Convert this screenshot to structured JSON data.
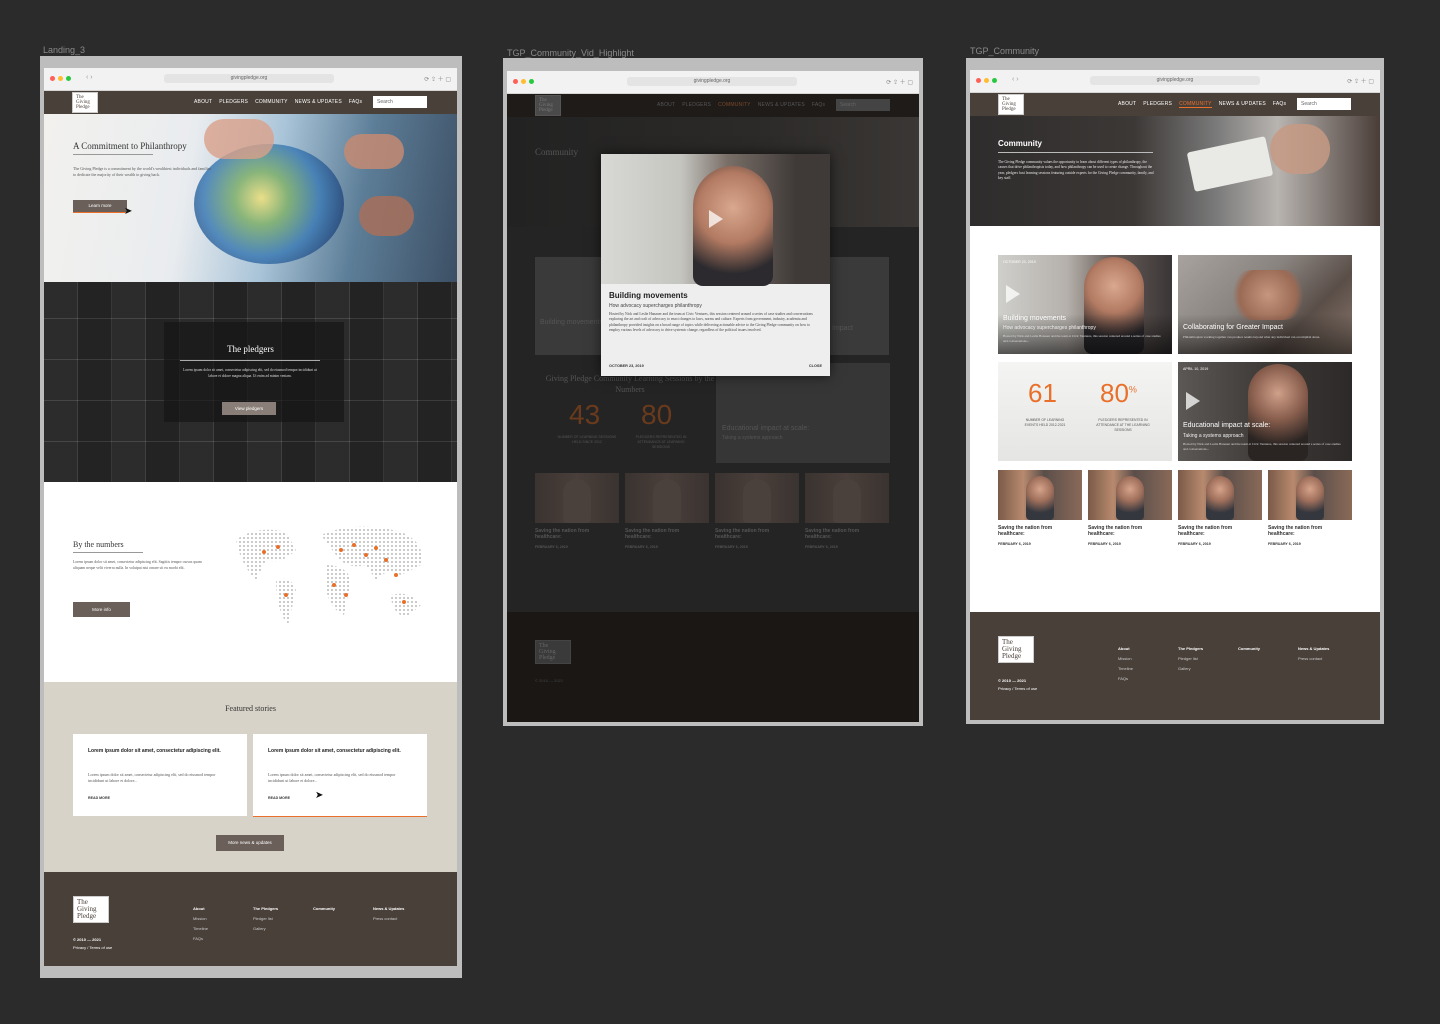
{
  "frames": {
    "landing_label": "Landing_3",
    "video_label": "TGP_Community_Vid_Highlight",
    "community_label": "TGP_Community"
  },
  "browser": {
    "url": "givingpledge.org"
  },
  "logo": {
    "l1": "The",
    "l2": "Giving",
    "l3": "Pledge"
  },
  "nav": {
    "about": "ABOUT",
    "pledgers": "PLEDGERS",
    "community": "COMMUNITY",
    "news": "NEWS & UPDATES",
    "faqs": "FAQs",
    "search_placeholder": "Search"
  },
  "landing": {
    "hero_title": "A Commitment to Philanthropy",
    "hero_body": "The Giving Pledge is a commitment by the world's wealthiest individuals and families to dedicate the majority of their wealth to giving back.",
    "hero_button": "Learn more",
    "pledgers_title": "The pledgers",
    "pledgers_body": "Lorem ipsum dolor sit amet, consectetur adipiscing elit, sed do eiusmod tempor incididunt ut labore et dolore magna aliqua. Ut enim ad minim veniam.",
    "pledgers_button": "View pledgers",
    "numbers_title": "By the numbers",
    "numbers_body": "Lorem ipsum dolor sit amet, consectetur adipiscing elit. Sagittis tempor cursus quam aliquam neque velit viverra nulla. In volutpat nisi ornare sit eu morbi elit.",
    "numbers_button": "More info",
    "featured_title": "Featured stories",
    "story1_title": "Lorem ipsum dolor sit amet, consectetur adipiscing elit.",
    "story1_body": "Lorem ipsum dolor sit amet, consectetur adipiscing elit, sed do eiusmod tempor incididunt ut labore et dolore...",
    "story1_link": "READ MORE",
    "story2_title": "Lorem ipsum dolor sit amet, consectetur adipiscing elit.",
    "story2_body": "Lorem ipsum dolor sit amet, consectetur adipiscing elit, sed do eiusmod tempor incididunt ut labore et dolore...",
    "story2_link": "READ MORE",
    "news_button": "More news & updates"
  },
  "footer": {
    "copyright": "© 2010 — 2021",
    "legal": "Privacy / Terms of use",
    "about_h": "About",
    "about_1": "Mission",
    "about_2": "Timeline",
    "about_3": "FAQs",
    "pledgers_h": "The Pledgers",
    "pledgers_1": "Pledger list",
    "pledgers_2": "Gallery",
    "community_h": "Community",
    "news_h": "News & Updates",
    "news_1": "Press contact"
  },
  "community": {
    "title": "Community",
    "intro": "The Giving Pledge community values the opportunity to learn about different types of philanthropy, the causes that drive philanthropists today, and how philanthropy can be used to create change. Throughout the year, pledgers host learning sessions featuring outside experts for the Giving Pledge community, family, and key staff.",
    "card1_date": "OCTOBER 23, 2019",
    "card1_title": "Building movements",
    "card1_sub": "How advocacy supercharges philanthropy",
    "card1_body": "Hosted by Nick and Leslie Hanauer and the team at Civic Ventures, this session centered around a series of case studies and conversations...",
    "card2_title": "Collaborating for Greater Impact",
    "card2_body": "Philanthropists working together can produce results beyond what any individual can accomplish alone.",
    "stat1_value": "61",
    "stat1_label": "NUMBER OF LEARNING EVENTS HELD 2012-2021",
    "stat2_value": "80",
    "stat2_sup": "%",
    "stat2_label": "PLEDGERS REPRESENTED IN ATTENDANCE AT THE LEARNING SESSIONS",
    "card3_date": "APRIL 10, 2019",
    "card3_title": "Educational impact at scale:",
    "card3_sub": "Taking a systems approach",
    "card3_body": "Hosted by Nick and Leslie Hanauer and the team at Civic Ventures, this session centered around a series of case studies and conversations...",
    "video_title": "Saving the nation from healthcare:",
    "video_date": "FEBRUARY 6, 2019"
  },
  "modal": {
    "title": "Building movements",
    "sub": "How advocacy supercharges philanthropy",
    "body": "Hosted by Nick and Leslie Hanauer and the team at Civic Ventures, this session centered around a series of case studies and conversations exploring the art and craft of advocacy to enact changes to laws, norms and culture. Experts from government, industry, academia and philanthropy provided insights on a broad range of topics while delivering actionable advice to the Giving Pledge community on how to employ various levels of advocacy to drive systemic change, regardless of the political issues involved.",
    "date": "OCTOBER 23, 2019",
    "close": "CLOSE"
  },
  "dim_section_title": "Giving Pledge Community Learning Sessions by the Numbers",
  "dim_stat1": "43",
  "dim_stat1_label": "NUMBER OF LEARNING SESSIONS HELD SINCE 2012",
  "dim_stat2": "80",
  "dim_stat2_label": "PLEDGERS REPRESENTED IN ATTENDANCE AT LEARNING SESSIONS",
  "dim_card_a": "Building movements",
  "dim_card_b": "Impact",
  "dim_card_c": "Educational impact at scale:",
  "dim_card_c_sub": "Taking a systems approach",
  "colors": {
    "brown": "#4a403a",
    "orange": "#e8702a",
    "beige": "#d8d3c8"
  }
}
